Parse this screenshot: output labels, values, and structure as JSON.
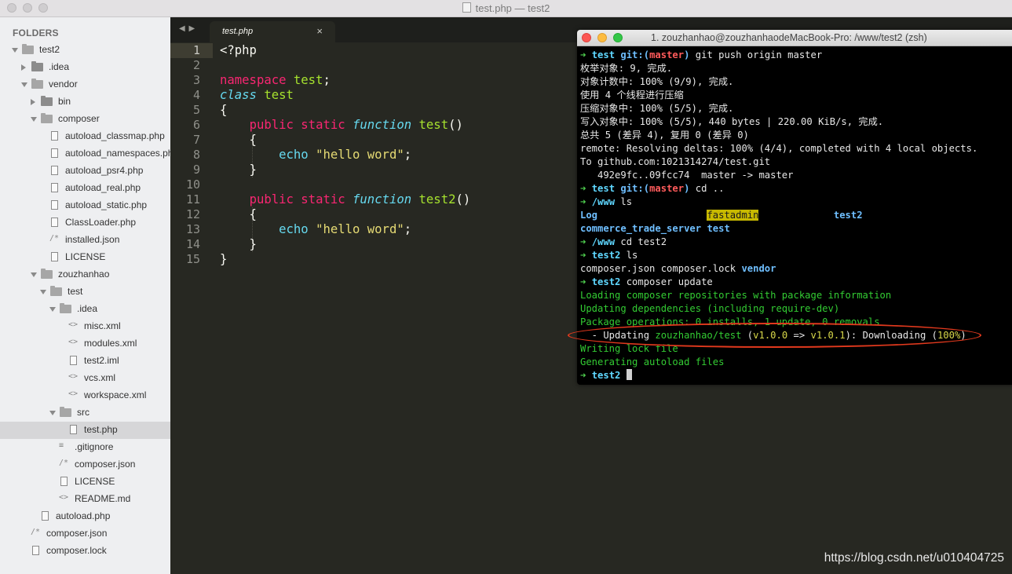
{
  "window": {
    "title": "test.php — test2"
  },
  "sidebar": {
    "header": "FOLDERS",
    "rows": [
      {
        "label": "test2",
        "depth": 0,
        "kind": "folder",
        "open": true
      },
      {
        "label": ".idea",
        "depth": 1,
        "kind": "folder",
        "open": false
      },
      {
        "label": "vendor",
        "depth": 1,
        "kind": "folder",
        "open": true
      },
      {
        "label": "bin",
        "depth": 2,
        "kind": "folder",
        "open": false
      },
      {
        "label": "composer",
        "depth": 2,
        "kind": "folder",
        "open": true
      },
      {
        "label": "autoload_classmap.php",
        "depth": 3,
        "kind": "file"
      },
      {
        "label": "autoload_namespaces.php",
        "depth": 3,
        "kind": "file"
      },
      {
        "label": "autoload_psr4.php",
        "depth": 3,
        "kind": "file"
      },
      {
        "label": "autoload_real.php",
        "depth": 3,
        "kind": "file"
      },
      {
        "label": "autoload_static.php",
        "depth": 3,
        "kind": "file"
      },
      {
        "label": "ClassLoader.php",
        "depth": 3,
        "kind": "file"
      },
      {
        "label": "installed.json",
        "depth": 3,
        "kind": "json"
      },
      {
        "label": "LICENSE",
        "depth": 3,
        "kind": "file"
      },
      {
        "label": "zouzhanhao",
        "depth": 2,
        "kind": "folder",
        "open": true
      },
      {
        "label": "test",
        "depth": 3,
        "kind": "folder",
        "open": true
      },
      {
        "label": ".idea",
        "depth": 4,
        "kind": "folder",
        "open": true
      },
      {
        "label": "misc.xml",
        "depth": 5,
        "kind": "code"
      },
      {
        "label": "modules.xml",
        "depth": 5,
        "kind": "code"
      },
      {
        "label": "test2.iml",
        "depth": 5,
        "kind": "file"
      },
      {
        "label": "vcs.xml",
        "depth": 5,
        "kind": "code"
      },
      {
        "label": "workspace.xml",
        "depth": 5,
        "kind": "code"
      },
      {
        "label": "src",
        "depth": 4,
        "kind": "folder",
        "open": true
      },
      {
        "label": "test.php",
        "depth": 5,
        "kind": "file",
        "selected": true
      },
      {
        "label": ".gitignore",
        "depth": 4,
        "kind": "list"
      },
      {
        "label": "composer.json",
        "depth": 4,
        "kind": "json"
      },
      {
        "label": "LICENSE",
        "depth": 4,
        "kind": "file"
      },
      {
        "label": "README.md",
        "depth": 4,
        "kind": "code"
      },
      {
        "label": "autoload.php",
        "depth": 2,
        "kind": "file"
      },
      {
        "label": "composer.json",
        "depth": 1,
        "kind": "json"
      },
      {
        "label": "composer.lock",
        "depth": 1,
        "kind": "file"
      }
    ]
  },
  "tabs": [
    {
      "label": "test.php",
      "close": "×",
      "active": true
    }
  ],
  "tabnav": "◀ ▶",
  "editor": {
    "line_numbers": [
      "1",
      "2",
      "3",
      "4",
      "5",
      "6",
      "7",
      "8",
      "9",
      "10",
      "11",
      "12",
      "13",
      "14",
      "15"
    ],
    "current_line": 1,
    "lines": [
      [
        {
          "t": "<?php",
          "c": ""
        }
      ],
      [],
      [
        {
          "t": "namespace",
          "c": "kw"
        },
        {
          "t": " ",
          "c": ""
        },
        {
          "t": "test",
          "c": "ent"
        },
        {
          "t": ";",
          "c": ""
        }
      ],
      [
        {
          "t": "class",
          "c": "cls"
        },
        {
          "t": " ",
          "c": ""
        },
        {
          "t": "test",
          "c": "ent"
        }
      ],
      [
        {
          "t": "{",
          "c": ""
        }
      ],
      [
        {
          "t": "    ",
          "c": ""
        },
        {
          "t": "public",
          "c": "kw"
        },
        {
          "t": " ",
          "c": ""
        },
        {
          "t": "static",
          "c": "kw"
        },
        {
          "t": " ",
          "c": ""
        },
        {
          "t": "function",
          "c": "cls"
        },
        {
          "t": " ",
          "c": ""
        },
        {
          "t": "test",
          "c": "ent"
        },
        {
          "t": "()",
          "c": ""
        }
      ],
      [
        {
          "t": "    {",
          "c": ""
        }
      ],
      [
        {
          "t": "        ",
          "c": ""
        },
        {
          "t": "echo",
          "c": "fn"
        },
        {
          "t": " ",
          "c": ""
        },
        {
          "t": "\"hello word\"",
          "c": "str"
        },
        {
          "t": ";",
          "c": ""
        }
      ],
      [
        {
          "t": "    }",
          "c": ""
        }
      ],
      [],
      [
        {
          "t": "    ",
          "c": ""
        },
        {
          "t": "public",
          "c": "kw"
        },
        {
          "t": " ",
          "c": ""
        },
        {
          "t": "static",
          "c": "kw"
        },
        {
          "t": " ",
          "c": ""
        },
        {
          "t": "function",
          "c": "cls"
        },
        {
          "t": " ",
          "c": ""
        },
        {
          "t": "test2",
          "c": "ent"
        },
        {
          "t": "()",
          "c": ""
        }
      ],
      [
        {
          "t": "    {",
          "c": ""
        }
      ],
      [
        {
          "t": "        ",
          "c": ""
        },
        {
          "t": "echo",
          "c": "fn"
        },
        {
          "t": " ",
          "c": ""
        },
        {
          "t": "\"hello word\"",
          "c": "str"
        },
        {
          "t": ";",
          "c": ""
        }
      ],
      [
        {
          "t": "    }",
          "c": ""
        }
      ],
      [
        {
          "t": "}",
          "c": ""
        }
      ]
    ]
  },
  "terminal": {
    "title": "1. zouzhanhao@zouzhanhaodeMacBook-Pro: /www/test2 (zsh)",
    "lines": [
      [
        {
          "t": "➜ ",
          "c": "g"
        },
        {
          "t": "test ",
          "c": "c"
        },
        {
          "t": "git:(",
          "c": "bl"
        },
        {
          "t": "master",
          "c": "r"
        },
        {
          "t": ")",
          "c": "bl"
        },
        {
          "t": " git push origin master",
          "c": ""
        }
      ],
      [
        {
          "t": "枚举对象: 9, 完成.",
          "c": ""
        }
      ],
      [
        {
          "t": "对象计数中: 100% (9/9), 完成.",
          "c": ""
        }
      ],
      [
        {
          "t": "使用 4 个线程进行压缩",
          "c": ""
        }
      ],
      [
        {
          "t": "压缩对象中: 100% (5/5), 完成.",
          "c": ""
        }
      ],
      [
        {
          "t": "写入对象中: 100% (5/5), 440 bytes | 220.00 KiB/s, 完成.",
          "c": ""
        }
      ],
      [
        {
          "t": "总共 5 (差异 4), 复用 0 (差异 0)",
          "c": ""
        }
      ],
      [
        {
          "t": "remote: Resolving deltas: 100% (4/4), completed with 4 local objects.",
          "c": ""
        }
      ],
      [
        {
          "t": "To github.com:1021314274/test.git",
          "c": ""
        }
      ],
      [
        {
          "t": "   492e9fc..09fcc74  master -> master",
          "c": ""
        }
      ],
      [
        {
          "t": "➜ ",
          "c": "g"
        },
        {
          "t": "test ",
          "c": "c"
        },
        {
          "t": "git:(",
          "c": "bl"
        },
        {
          "t": "master",
          "c": "r"
        },
        {
          "t": ")",
          "c": "bl"
        },
        {
          "t": " cd ..",
          "c": ""
        }
      ],
      [
        {
          "t": "➜ ",
          "c": "g"
        },
        {
          "t": "/www",
          "c": "c"
        },
        {
          "t": " ls",
          "c": ""
        }
      ],
      [
        {
          "t": "Log",
          "c": "bl"
        },
        {
          "t": "                   ",
          "c": ""
        },
        {
          "t": "fastadmin",
          "c": "fa"
        },
        {
          "t": "             ",
          "c": ""
        },
        {
          "t": "test2",
          "c": "bl"
        }
      ],
      [
        {
          "t": "commerce_trade_server",
          "c": "bl"
        },
        {
          "t": " ",
          "c": ""
        },
        {
          "t": "test",
          "c": "bl"
        }
      ],
      [
        {
          "t": "➜ ",
          "c": "g"
        },
        {
          "t": "/www",
          "c": "c"
        },
        {
          "t": " cd test2",
          "c": ""
        }
      ],
      [
        {
          "t": "➜ ",
          "c": "g"
        },
        {
          "t": "test2",
          "c": "c"
        },
        {
          "t": " ls",
          "c": ""
        }
      ],
      [
        {
          "t": "composer.json composer.lock ",
          "c": ""
        },
        {
          "t": "vendor",
          "c": "bl"
        }
      ],
      [
        {
          "t": "➜ ",
          "c": "g"
        },
        {
          "t": "test2",
          "c": "c"
        },
        {
          "t": " composer update",
          "c": ""
        }
      ],
      [
        {
          "t": "Loading composer repositories with package information",
          "c": "grn"
        }
      ],
      [
        {
          "t": "Updating dependencies (including require-dev)",
          "c": "grn"
        }
      ],
      [
        {
          "t": "Package operations: 0 installs, 1 update, 0 removals",
          "c": "grn"
        }
      ],
      [
        {
          "t": "  - Updating ",
          "c": ""
        },
        {
          "t": "zouzhanhao/test",
          "c": "grn"
        },
        {
          "t": " (",
          "c": ""
        },
        {
          "t": "v1.0.0",
          "c": "yel"
        },
        {
          "t": " => ",
          "c": ""
        },
        {
          "t": "v1.0.1",
          "c": "yel"
        },
        {
          "t": "): Downloading (",
          "c": ""
        },
        {
          "t": "100%",
          "c": "yel"
        },
        {
          "t": ")",
          "c": ""
        }
      ],
      [
        {
          "t": "Writing lock file",
          "c": "grn"
        }
      ],
      [
        {
          "t": "Generating autoload files",
          "c": "grn"
        }
      ],
      [
        {
          "t": "➜ ",
          "c": "g"
        },
        {
          "t": "test2",
          "c": "c"
        },
        {
          "t": " ",
          "c": ""
        }
      ]
    ]
  },
  "watermark": "https://blog.csdn.net/u010404725"
}
